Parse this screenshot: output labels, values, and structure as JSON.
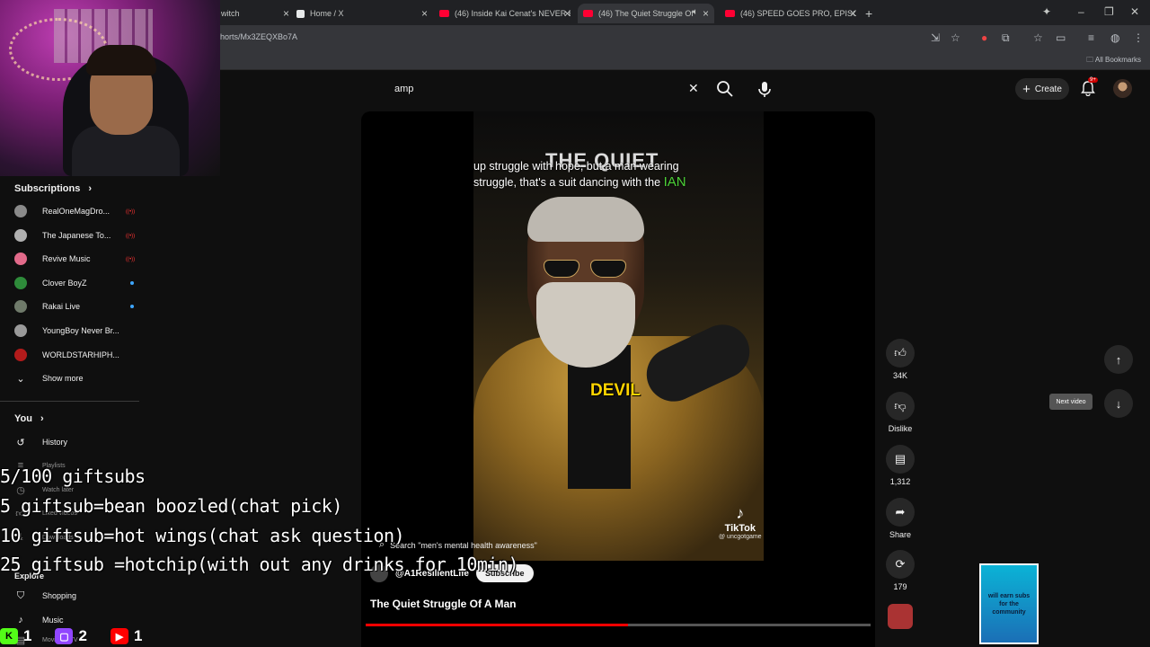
{
  "browser": {
    "tabs": [
      {
        "title": "witch",
        "favicon_color": "#9146ff"
      },
      {
        "title": "Home / X",
        "favicon_color": "#e7e9ea"
      },
      {
        "title": "(46) Inside Kai Cenat's NEVER E",
        "favicon_color": "#ff0033"
      },
      {
        "title": "(46) The Quiet Struggle Of",
        "favicon_color": "#ff0033"
      },
      {
        "title": "(46) SPEED GOES PRO, EPISODI",
        "favicon_color": "#ff0033"
      }
    ],
    "new_tab_label": "+",
    "url": "horts/Mx3ZEQXBo7A",
    "bookmarks_label": "All Bookmarks"
  },
  "youtube": {
    "search_value": "amp",
    "create_label": "Create",
    "notifications_badge": "9+"
  },
  "sidebar": {
    "subscriptions_title": "Subscriptions",
    "subscriptions": [
      {
        "name": "RealOneMagDro...",
        "color": "#8a8a8a",
        "status": "live"
      },
      {
        "name": "The Japanese To...",
        "color": "#b0b0b0",
        "status": "live"
      },
      {
        "name": "Revive Music",
        "color": "#e26a8a",
        "status": "live"
      },
      {
        "name": "Clover BoyZ",
        "color": "#2e8b3a",
        "status": "new"
      },
      {
        "name": "Rakai Live",
        "color": "#6f7a6a",
        "status": "new"
      },
      {
        "name": "YoungBoy Never Br...",
        "color": "#9a9a9a",
        "status": ""
      },
      {
        "name": "WORLDSTARHIPH...",
        "color": "#b31b1b",
        "status": ""
      }
    ],
    "show_more": "Show more",
    "you_title": "You",
    "you_items": [
      {
        "label": "History",
        "icon": "history-icon"
      },
      {
        "label": "Playlists",
        "icon": "playlist-icon"
      },
      {
        "label": "Watch later",
        "icon": "clock-icon"
      },
      {
        "label": "Liked videos",
        "icon": "like-icon"
      },
      {
        "label": "Downloads",
        "icon": "download-icon"
      }
    ],
    "explore_title": "Explore",
    "explore_items": [
      {
        "label": "Shopping",
        "icon": "bag-icon"
      },
      {
        "label": "Music",
        "icon": "music-icon"
      },
      {
        "label": "Movies & TV",
        "icon": "film-icon"
      }
    ]
  },
  "stream_overlay": {
    "lines": [
      "5/100 giftsubs",
      "5 giftsub=bean boozled(chat pick)",
      "10 giftsub=hot wings(chat ask question)",
      "25 giftsub =hotchip(with out any drinks for 10min)"
    ],
    "stats": [
      {
        "platform": "kick",
        "count": "1",
        "color": "#53fc18"
      },
      {
        "platform": "twitch",
        "count": "2",
        "color": "#9146ff"
      },
      {
        "platform": "youtube",
        "count": "1",
        "color": "#ff0000"
      }
    ]
  },
  "short": {
    "overlay_title": "THE QUIET",
    "caption_line1": "up struggle with hope, but a man wearing",
    "caption_line2": "struggle, that's a suit dancing with the",
    "caption_highlight": "IAN",
    "devil_text": "DEVIL",
    "tiktok_label": "TikTok",
    "tiktok_handle": "@ uncgotgame",
    "search_suggestion": "Search \"men's mental health awareness\"",
    "channel": "@A1ResilientLife",
    "subscribe_label": "Subscribe",
    "title": "The Quiet Struggle Of A Man",
    "progress": 0.52
  },
  "actions": {
    "likes": "34K",
    "dislike_label": "Dislike",
    "comments": "1,312",
    "share_label": "Share",
    "remix": "179"
  },
  "navigation": {
    "tooltip": "Next video"
  },
  "ad_text": "will earn subs for the community"
}
